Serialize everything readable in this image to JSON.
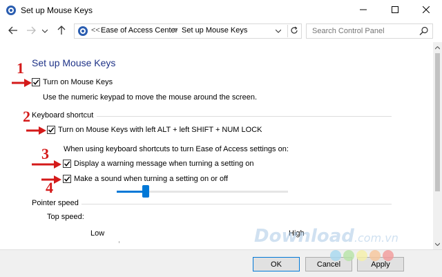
{
  "window": {
    "title": "Set up Mouse Keys"
  },
  "address_bar": {
    "chevron": "<<",
    "breadcrumbs": [
      "Ease of Access Center",
      "Set up Mouse Keys"
    ],
    "separator": ">"
  },
  "search": {
    "placeholder": "Search Control Panel"
  },
  "content": {
    "heading": "Set up Mouse Keys",
    "turn_on": {
      "checked": true,
      "label": "Turn on Mouse Keys"
    },
    "turn_on_desc": "Use the numeric keypad to move the mouse around the screen.",
    "keyboard_shortcut": {
      "title": "Keyboard shortcut",
      "turn_on_shortcut": {
        "checked": true,
        "label": "Turn on Mouse Keys with left ALT + left SHIFT + NUM LOCK"
      },
      "when_text": "When using keyboard shortcuts to turn Ease of Access settings on:",
      "warning": {
        "checked": true,
        "label": "Display a warning message when turning a setting on"
      },
      "sound": {
        "checked": true,
        "label": "Make a sound when turning a setting on or off"
      }
    },
    "pointer_speed": {
      "title": "Pointer speed",
      "top_speed_label": "Top speed:",
      "low_label": "Low",
      "high_label": "High",
      "top_speed_fraction": 0.17
    }
  },
  "footer": {
    "ok_label": "OK",
    "cancel_label": "Cancel",
    "apply_label": "Apply"
  },
  "annotations": [
    "1",
    "2",
    "3",
    "4"
  ],
  "watermark": {
    "main": "Download",
    "suffix": ".com.vn"
  },
  "colors": {
    "heading": "#1e3287",
    "accent": "#0078d7",
    "annotation": "#d41a1a",
    "watermark_dots": [
      "#a6d8f0",
      "#b6e3a6",
      "#f5f0a8",
      "#f7c59a",
      "#f29a9a"
    ]
  }
}
